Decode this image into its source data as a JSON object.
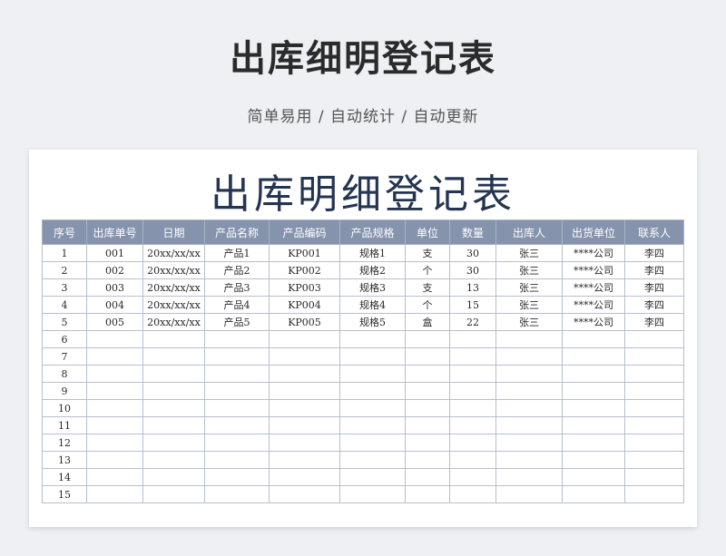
{
  "page": {
    "title": "出库细明登记表",
    "subtitle": "简单易用 / 自动统计 / 自动更新"
  },
  "sheet": {
    "title": "出库明细登记表",
    "columns": [
      "序号",
      "出库单号",
      "日期",
      "产品名称",
      "产品编码",
      "产品规格",
      "单位",
      "数量",
      "出库人",
      "出货单位",
      "联系人"
    ],
    "rows": [
      [
        "1",
        "001",
        "20xx/xx/xx",
        "产品1",
        "KP001",
        "规格1",
        "支",
        "30",
        "张三",
        "****公司",
        "李四"
      ],
      [
        "2",
        "002",
        "20xx/xx/xx",
        "产品2",
        "KP002",
        "规格2",
        "个",
        "30",
        "张三",
        "****公司",
        "李四"
      ],
      [
        "3",
        "003",
        "20xx/xx/xx",
        "产品3",
        "KP003",
        "规格3",
        "支",
        "13",
        "张三",
        "****公司",
        "李四"
      ],
      [
        "4",
        "004",
        "20xx/xx/xx",
        "产品4",
        "KP004",
        "规格4",
        "个",
        "15",
        "张三",
        "****公司",
        "李四"
      ],
      [
        "5",
        "005",
        "20xx/xx/xx",
        "产品5",
        "KP005",
        "规格5",
        "盒",
        "22",
        "张三",
        "****公司",
        "李四"
      ],
      [
        "6",
        "",
        "",
        "",
        "",
        "",
        "",
        "",
        "",
        "",
        ""
      ],
      [
        "7",
        "",
        "",
        "",
        "",
        "",
        "",
        "",
        "",
        "",
        ""
      ],
      [
        "8",
        "",
        "",
        "",
        "",
        "",
        "",
        "",
        "",
        "",
        ""
      ],
      [
        "9",
        "",
        "",
        "",
        "",
        "",
        "",
        "",
        "",
        "",
        ""
      ],
      [
        "10",
        "",
        "",
        "",
        "",
        "",
        "",
        "",
        "",
        "",
        ""
      ],
      [
        "11",
        "",
        "",
        "",
        "",
        "",
        "",
        "",
        "",
        "",
        ""
      ],
      [
        "12",
        "",
        "",
        "",
        "",
        "",
        "",
        "",
        "",
        "",
        ""
      ],
      [
        "13",
        "",
        "",
        "",
        "",
        "",
        "",
        "",
        "",
        "",
        ""
      ],
      [
        "14",
        "",
        "",
        "",
        "",
        "",
        "",
        "",
        "",
        "",
        ""
      ],
      [
        "15",
        "",
        "",
        "",
        "",
        "",
        "",
        "",
        "",
        "",
        ""
      ]
    ]
  },
  "colors": {
    "header_bg": "#8593ad",
    "title_color": "#243552",
    "page_bg": "#eef0f4"
  }
}
